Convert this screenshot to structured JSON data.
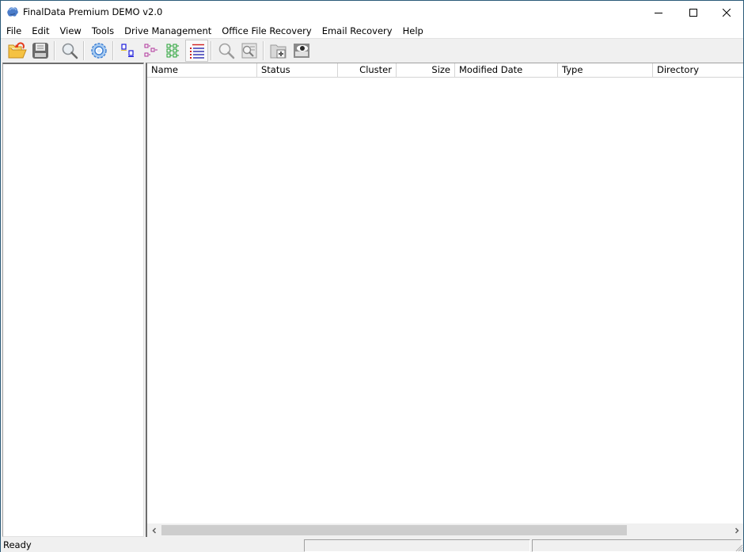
{
  "window": {
    "title": "FinalData Premium DEMO v2.0",
    "controls": {
      "minimize": "minimize-icon",
      "maximize": "maximize-icon",
      "close": "close-icon"
    }
  },
  "menubar": {
    "items": [
      {
        "label": "File"
      },
      {
        "label": "Edit"
      },
      {
        "label": "View"
      },
      {
        "label": "Tools"
      },
      {
        "label": "Drive Management"
      },
      {
        "label": "Office File Recovery"
      },
      {
        "label": "Email Recovery"
      },
      {
        "label": "Help"
      }
    ]
  },
  "toolbar": {
    "buttons": [
      {
        "icon": "open-folder-icon",
        "tooltip": "Open"
      },
      {
        "icon": "save-icon",
        "tooltip": "Save"
      },
      {
        "icon": "search-icon",
        "tooltip": "Find"
      },
      {
        "icon": "settings-gear-icon",
        "tooltip": "Settings"
      },
      {
        "icon": "small-icons-view-icon",
        "tooltip": "Small Icons"
      },
      {
        "icon": "tree-view-icon",
        "tooltip": "Tree"
      },
      {
        "icon": "list-view-icon",
        "tooltip": "List"
      },
      {
        "icon": "details-view-icon",
        "tooltip": "Details",
        "active": true
      },
      {
        "icon": "zoom-icon",
        "tooltip": "Zoom"
      },
      {
        "icon": "preview-search-icon",
        "tooltip": "Preview"
      },
      {
        "icon": "new-folder-icon",
        "tooltip": "New Folder"
      },
      {
        "icon": "view-eye-icon",
        "tooltip": "View"
      }
    ]
  },
  "file_list": {
    "columns": [
      {
        "label": "Name",
        "align": "left"
      },
      {
        "label": "Status",
        "align": "left"
      },
      {
        "label": "Cluster",
        "align": "right"
      },
      {
        "label": "Size",
        "align": "right"
      },
      {
        "label": "Modified Date",
        "align": "left"
      },
      {
        "label": "Type",
        "align": "left"
      },
      {
        "label": "Directory",
        "align": "left"
      }
    ],
    "rows": []
  },
  "scrollbar": {
    "left_arrow": "<",
    "right_arrow": ">",
    "thumb_fraction": 0.82,
    "position": 0
  },
  "statusbar": {
    "text": "Ready",
    "panel1": "",
    "panel2": ""
  },
  "colors": {
    "window_border": "#2b5a78",
    "chrome_bg": "#f0f0f0",
    "pane_bg": "#ffffff"
  }
}
